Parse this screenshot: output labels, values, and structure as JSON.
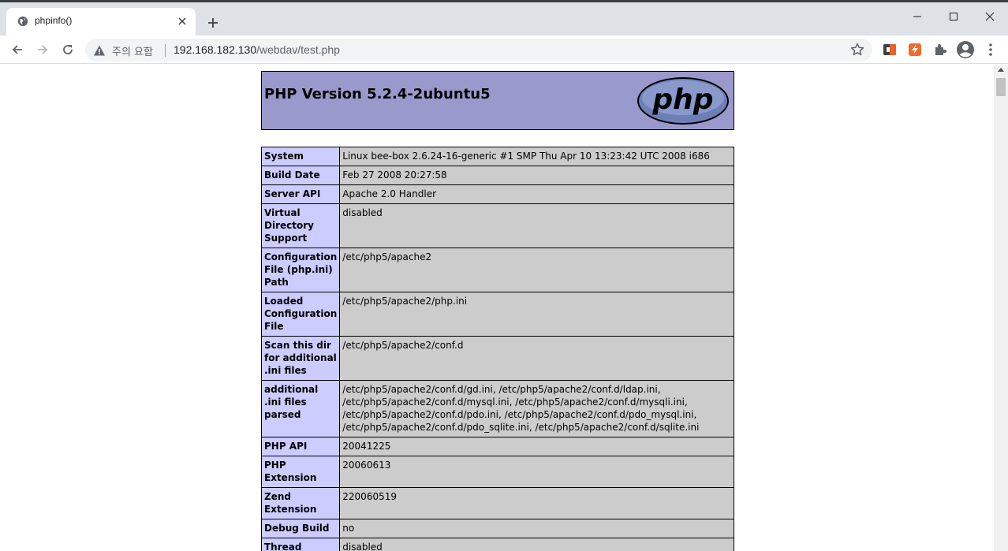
{
  "browser": {
    "tab_title": "phpinfo()",
    "security_label": "주의 요함",
    "url_host": "192.168.182.130",
    "url_path": "/webdav/test.php",
    "icons": [
      "globe-icon",
      "close-icon",
      "plus-icon",
      "minimize-icon",
      "maximize-icon",
      "close-window-icon",
      "back-icon",
      "forward-icon",
      "reload-icon",
      "warning-icon",
      "star-icon",
      "extension-icon",
      "puzzle-icon",
      "profile-icon",
      "menu-icon"
    ]
  },
  "page": {
    "header_title": "PHP Version 5.2.4-2ubuntu5",
    "logo_text": "php",
    "colors": {
      "header_bg": "#9999cc",
      "key_bg": "#ccccff",
      "value_bg": "#cccccc"
    },
    "rows": [
      {
        "key": "System",
        "value": "Linux bee-box 2.6.24-16-generic #1 SMP Thu Apr 10 13:23:42 UTC 2008 i686"
      },
      {
        "key": "Build Date",
        "value": "Feb 27 2008 20:27:58"
      },
      {
        "key": "Server API",
        "value": "Apache 2.0 Handler"
      },
      {
        "key": "Virtual Directory Support",
        "value": "disabled"
      },
      {
        "key": "Configuration File (php.ini) Path",
        "value": "/etc/php5/apache2"
      },
      {
        "key": "Loaded Configuration File",
        "value": "/etc/php5/apache2/php.ini"
      },
      {
        "key": "Scan this dir for additional .ini files",
        "value": "/etc/php5/apache2/conf.d"
      },
      {
        "key": "additional .ini files parsed",
        "value": "/etc/php5/apache2/conf.d/gd.ini, /etc/php5/apache2/conf.d/ldap.ini, /etc/php5/apache2/conf.d/mysql.ini, /etc/php5/apache2/conf.d/mysqli.ini, /etc/php5/apache2/conf.d/pdo.ini, /etc/php5/apache2/conf.d/pdo_mysql.ini, /etc/php5/apache2/conf.d/pdo_sqlite.ini, /etc/php5/apache2/conf.d/sqlite.ini"
      },
      {
        "key": "PHP API",
        "value": "20041225"
      },
      {
        "key": "PHP Extension",
        "value": "20060613"
      },
      {
        "key": "Zend Extension",
        "value": "220060519"
      },
      {
        "key": "Debug Build",
        "value": "no"
      },
      {
        "key": "Thread Safety",
        "value": "disabled"
      }
    ]
  }
}
